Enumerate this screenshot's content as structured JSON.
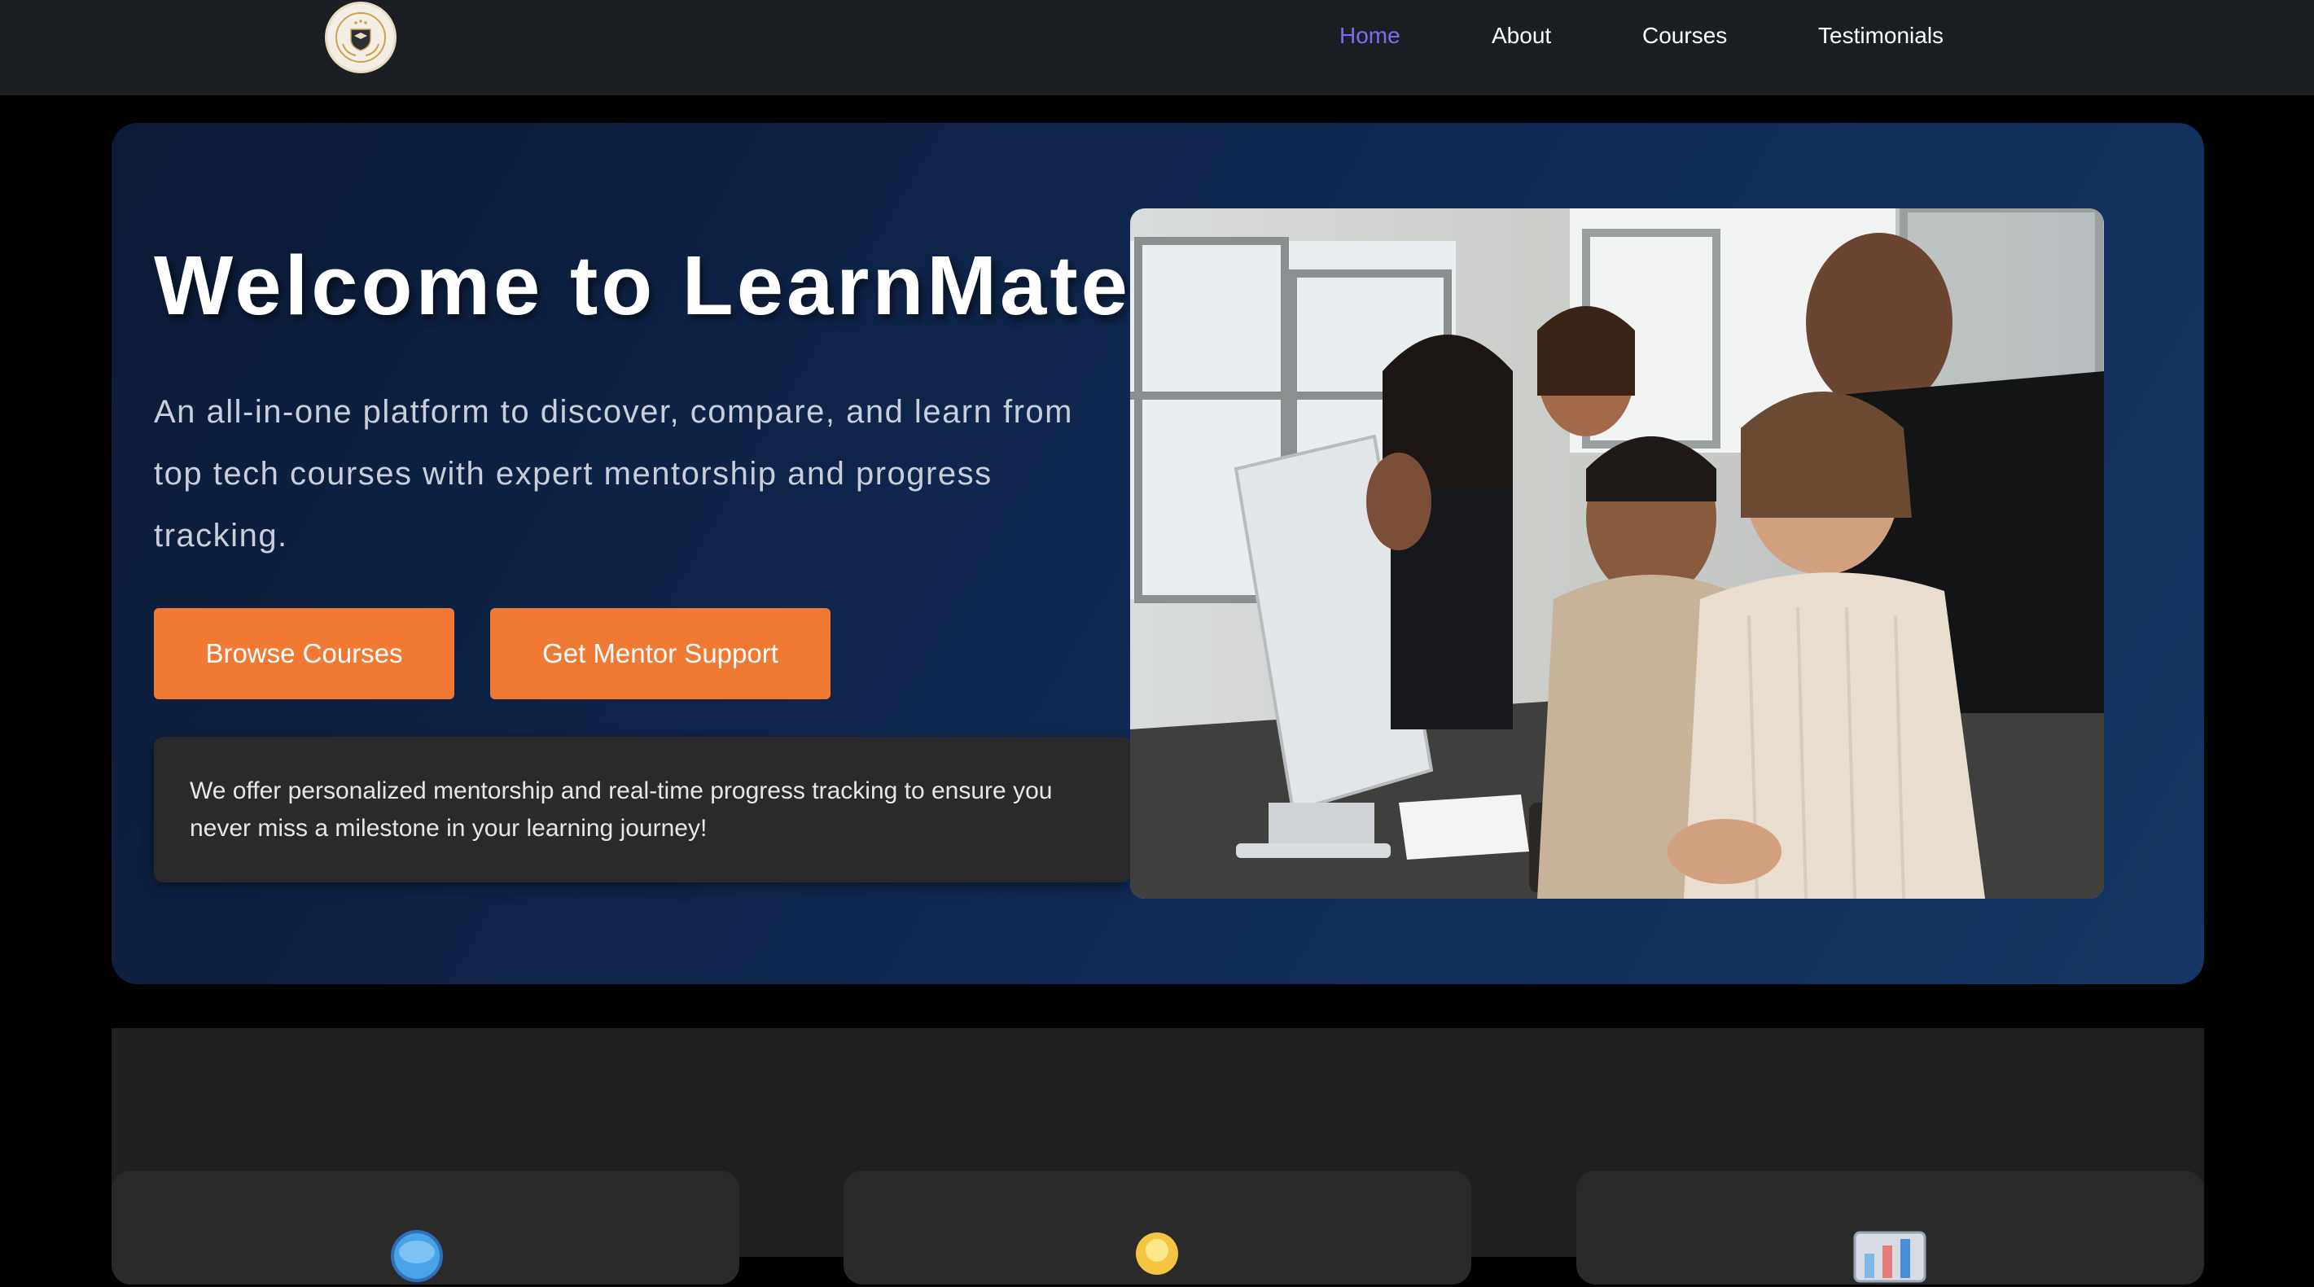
{
  "nav": {
    "logo_icon": "graduation-shield-emblem",
    "links": [
      {
        "label": "Home",
        "active": true
      },
      {
        "label": "About",
        "active": false
      },
      {
        "label": "Courses",
        "active": false
      },
      {
        "label": "Testimonials",
        "active": false
      }
    ],
    "active_color": "#7c6cf2"
  },
  "hero": {
    "title": "Welcome to LearnMate",
    "subtitle": "An all-in-one platform to discover, compare, and learn from top tech courses with expert mentorship and progress tracking.",
    "buttons": {
      "browse_label": "Browse Courses",
      "mentor_label": "Get Mentor Support"
    },
    "info_text": "We offer personalized mentorship and real-time progress tracking to ensure you never miss a milestone in your learning journey!",
    "image_description": "team-collaborating-at-computer-photo",
    "accent_color": "#f07a33"
  },
  "features": {
    "cards": [
      {
        "icon": "globe-icon"
      },
      {
        "icon": "lightbulb-icon"
      },
      {
        "icon": "chart-icon"
      }
    ]
  }
}
